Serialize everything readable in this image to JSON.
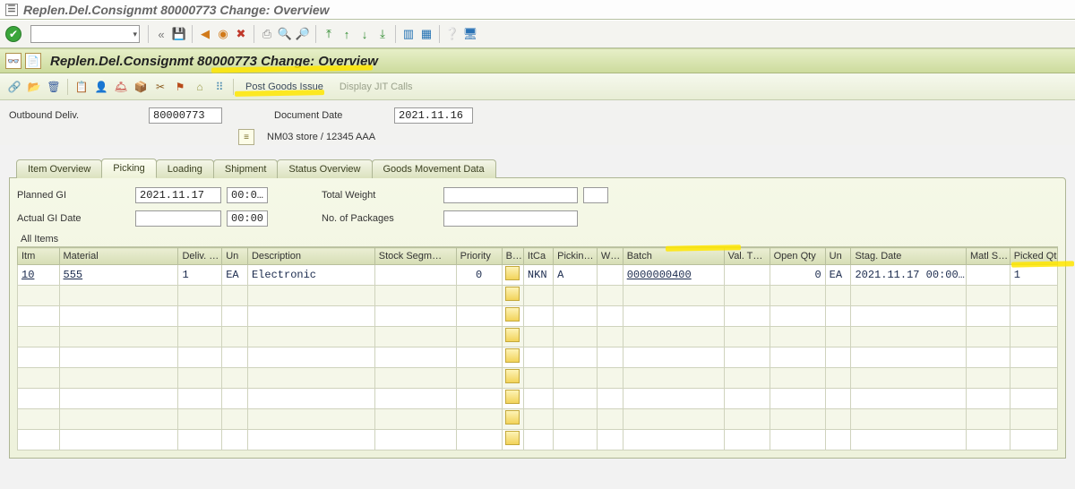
{
  "window_title": "Replen.Del.Consignmt 80000773 Change: Overview",
  "page_title": "Replen.Del.Consignmt 80000773 Change: Overview",
  "header": {
    "outbound_deliv_label": "Outbound Deliv.",
    "outbound_deliv_value": "80000773",
    "document_date_label": "Document Date",
    "document_date_value": "2021.11.16",
    "store_text": "NM03 store / 12345 AAA"
  },
  "app_toolbar": {
    "post_goods_issue": "Post Goods Issue",
    "display_jit_calls": "Display JIT Calls"
  },
  "tabs": {
    "item_overview": "Item Overview",
    "picking": "Picking",
    "loading": "Loading",
    "shipment": "Shipment",
    "status_overview": "Status Overview",
    "goods_movement_data": "Goods Movement Data"
  },
  "picking_tab": {
    "planned_gi_label": "Planned GI",
    "planned_gi_date": "2021.11.17",
    "planned_gi_time": "00:0…",
    "actual_gi_label": "Actual GI Date",
    "actual_gi_date": "",
    "actual_gi_time": "00:00",
    "total_weight_label": "Total Weight",
    "total_weight_value": "",
    "total_weight_unit": "",
    "no_of_packages_label": "No. of Packages",
    "no_of_packages_value": ""
  },
  "grid": {
    "title": "All Items",
    "columns": {
      "itm": "Itm",
      "material": "Material",
      "deliv_qty": "Deliv. …",
      "un1": "Un",
      "description": "Description",
      "stock_segm": "Stock Segm…",
      "priority": "Priority",
      "b": "B…",
      "itca": "ItCa",
      "picking": "Pickin…",
      "w": "W…",
      "batch": "Batch",
      "val_t": "Val. T…",
      "open_qty": "Open Qty",
      "un2": "Un",
      "stag_date": "Stag. Date",
      "matl_s": "Matl S…",
      "picked_qty": "Picked Qt"
    },
    "rows": [
      {
        "itm": "10",
        "material": "555",
        "deliv_qty": "1",
        "un1": "EA",
        "description": "Electronic",
        "stock_segm": "",
        "priority": "0",
        "b": "",
        "itca": "NKN",
        "picking": "A",
        "w": "",
        "batch": "0000000400",
        "val_t": "",
        "open_qty": "0",
        "un2": "EA",
        "stag_date": "2021.11.17 00:00…",
        "matl_s": "",
        "picked_qty": "1"
      }
    ]
  }
}
